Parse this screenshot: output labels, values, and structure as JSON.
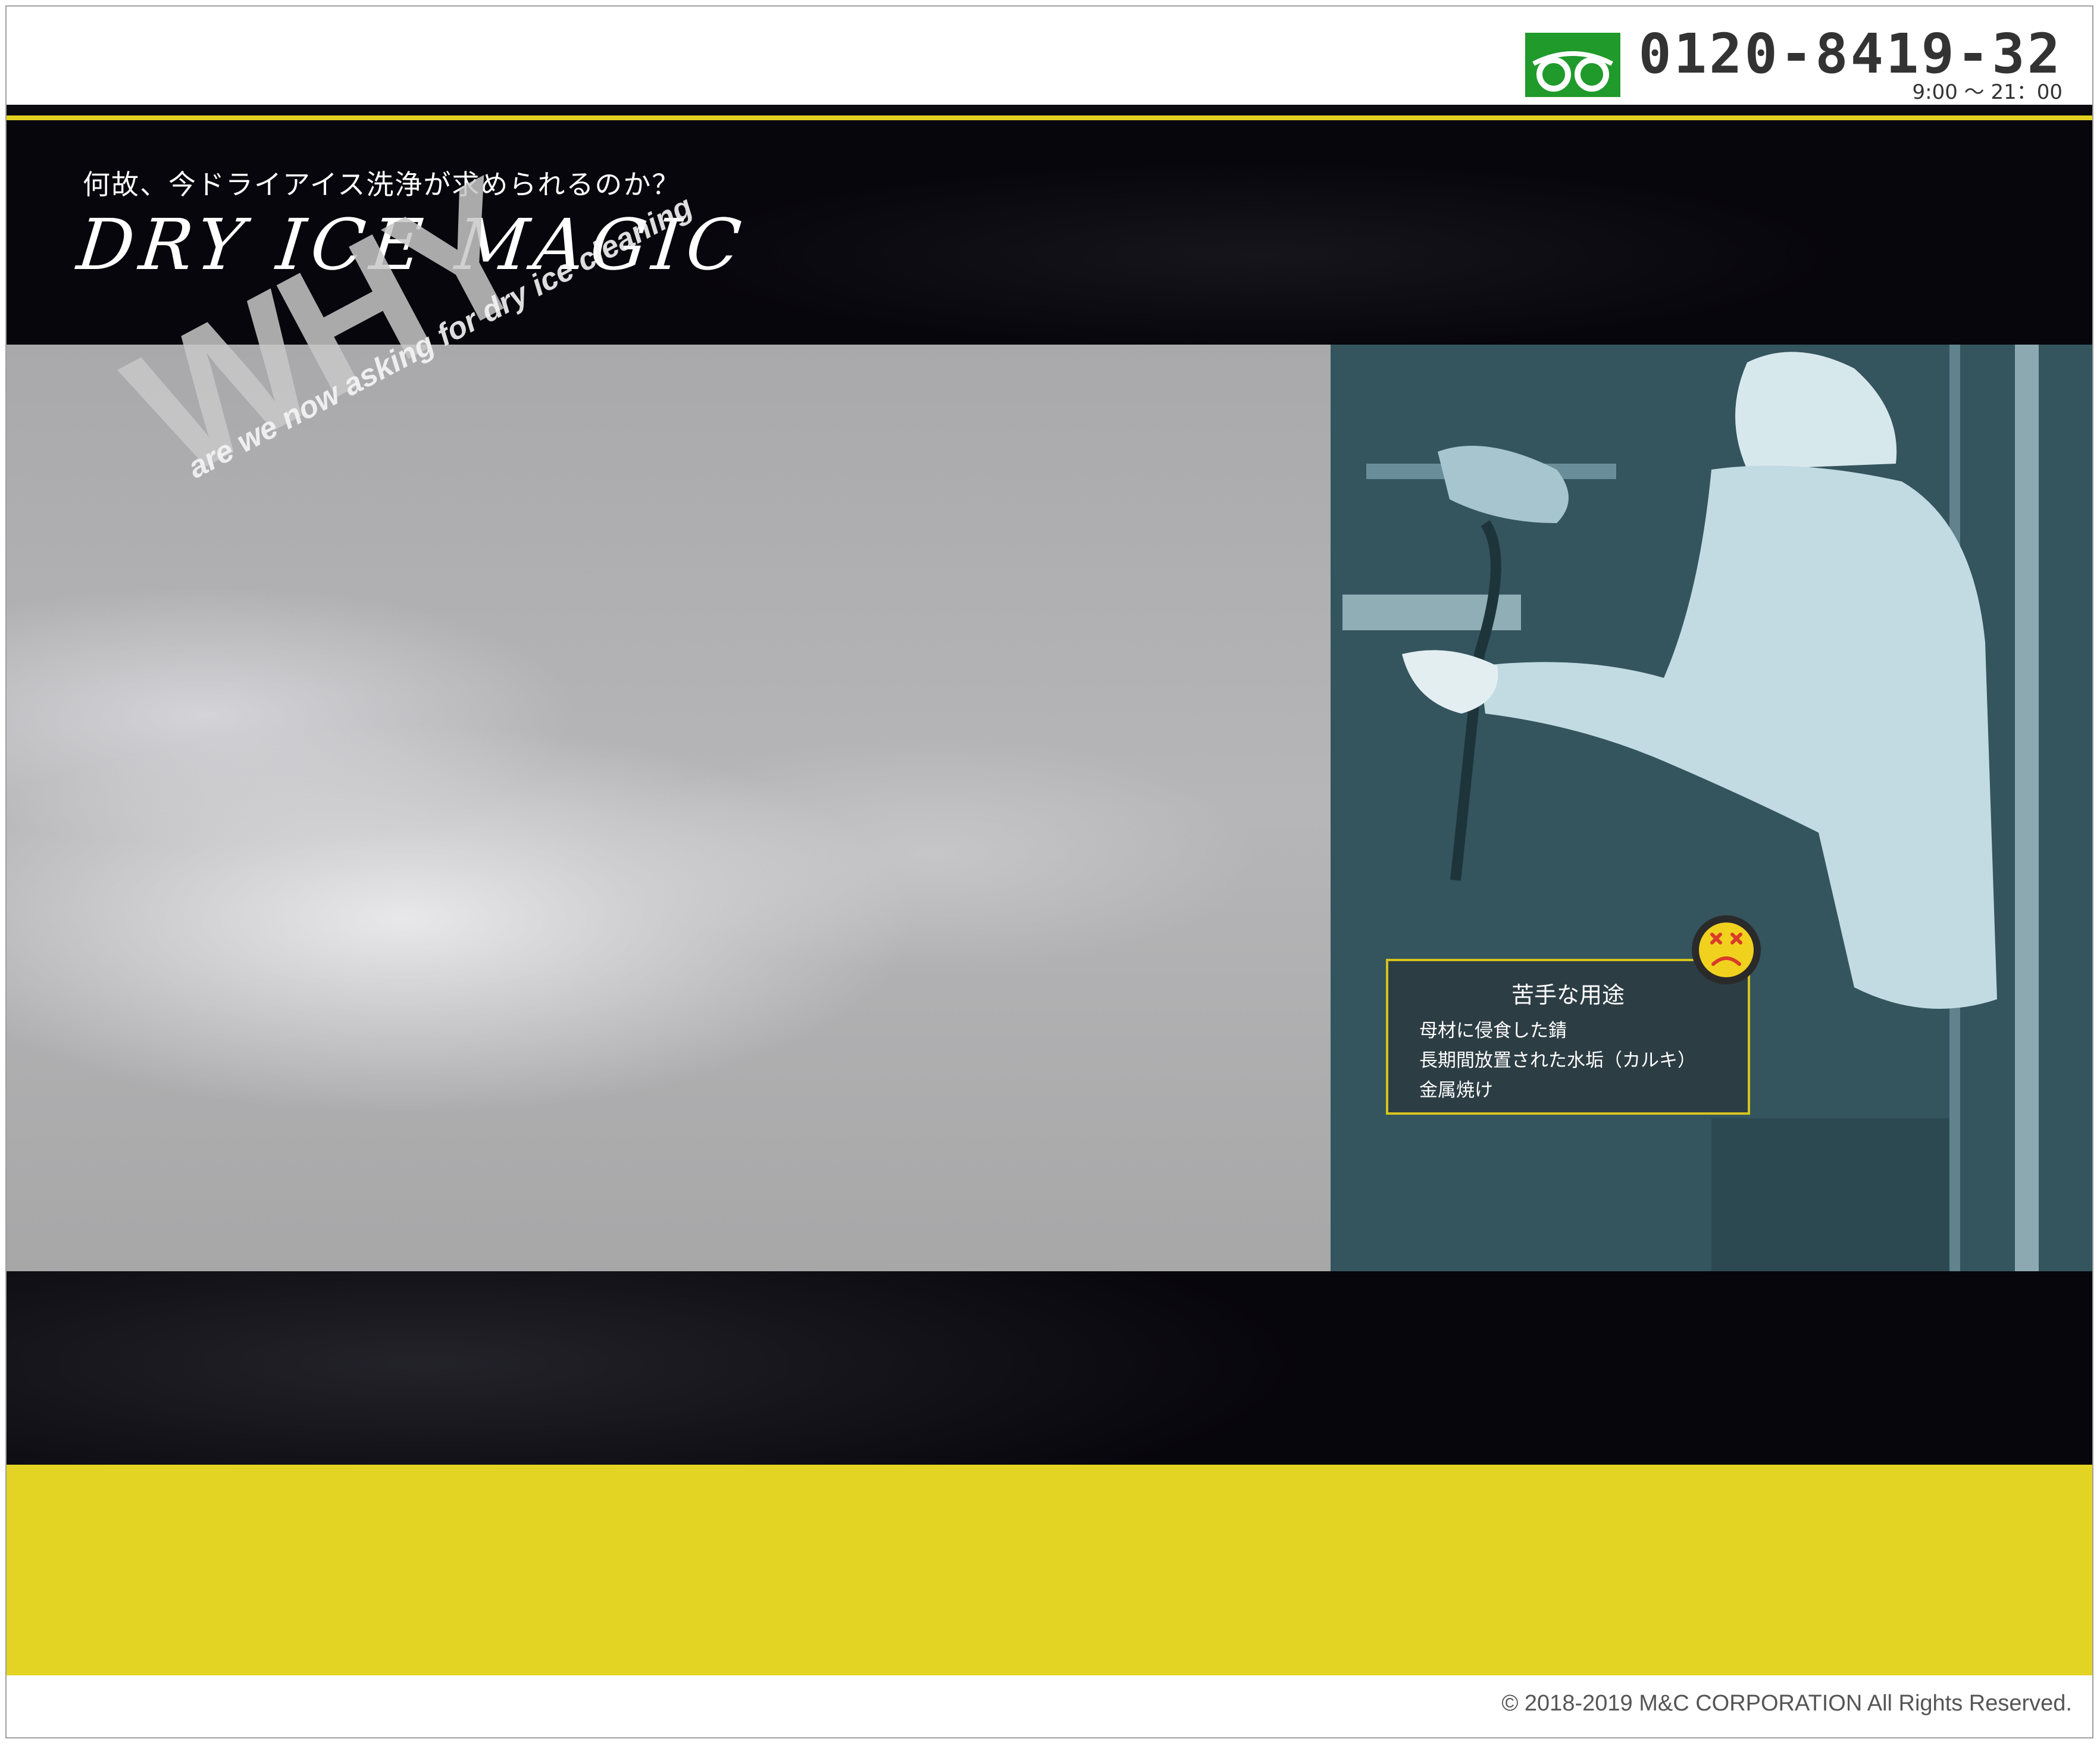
{
  "header": {
    "phone_number": "0120-8419-32",
    "hours": "9:00 ～ 21：00",
    "freedial_icon": "freedial-icon"
  },
  "hero": {
    "subtitle": "何故、今ドライアイス洗浄が求められるのか？",
    "logo_text": "DRY ICE MAGIC",
    "why_word": "WHY",
    "why_tagline": "are we now asking for dry ice cleaning"
  },
  "weak_uses": {
    "title": "苦手な用途",
    "items": [
      "母材に侵食した錆",
      "長期間放置された水垢（カルキ）",
      "金属焼け"
    ],
    "icon": "sad-face-icon"
  },
  "footer": {
    "copyright": "© 2018-2019 M&C CORPORATION All Rights Reserved."
  },
  "colors": {
    "accent_yellow": "#e3d323",
    "freedial_green": "#1f9a2b",
    "dark_bg": "#07060c"
  }
}
